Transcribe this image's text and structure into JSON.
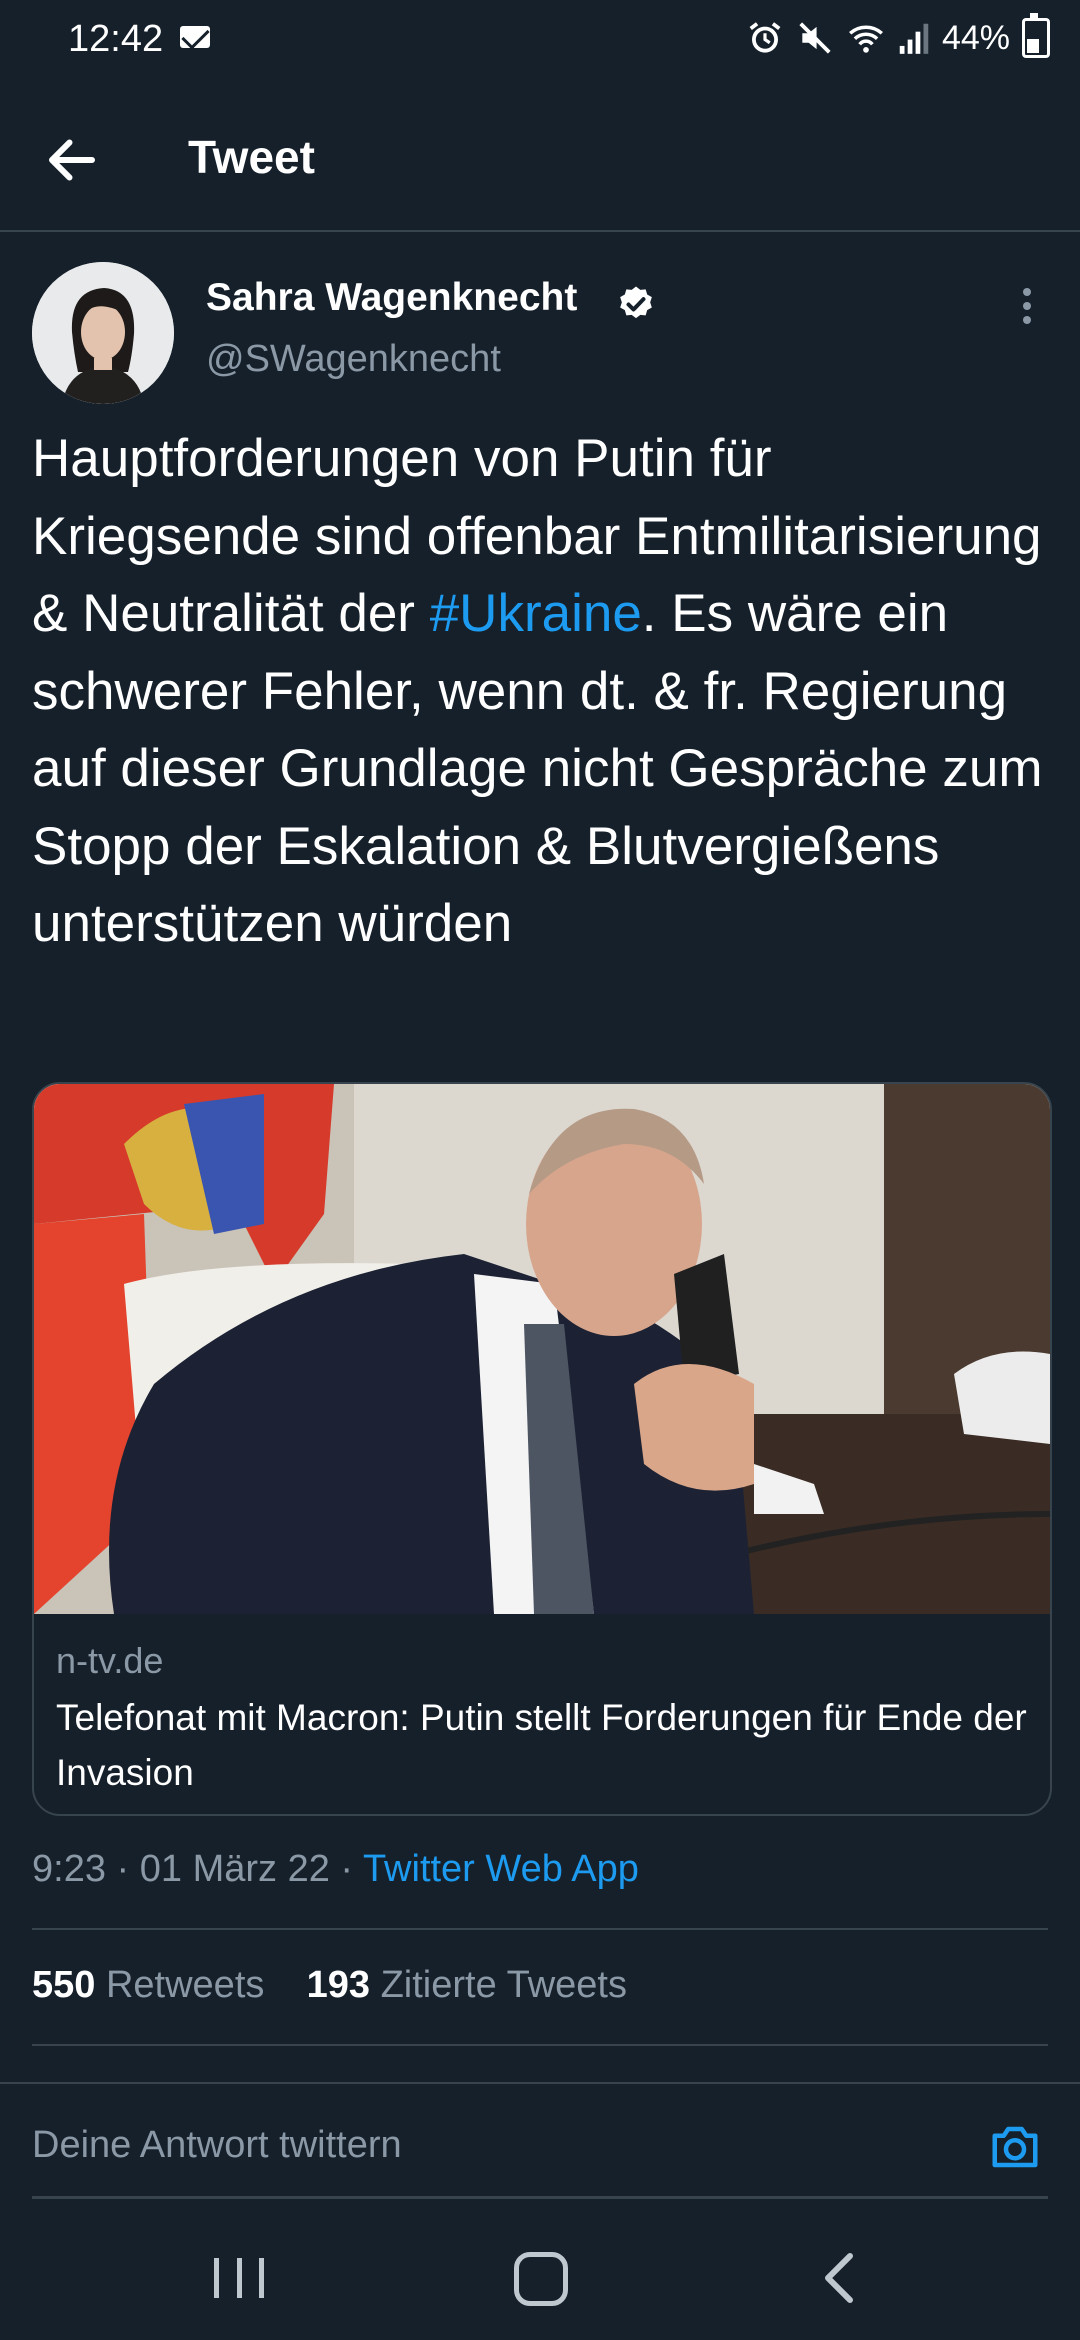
{
  "status_bar": {
    "time": "12:42",
    "battery": "44%",
    "icons": [
      "mail-icon",
      "alarm-icon",
      "mute-icon",
      "wifi-icon",
      "signal-icon",
      "battery-icon"
    ]
  },
  "header": {
    "title": "Tweet"
  },
  "tweet": {
    "author_name": "Sahra Wagenknecht",
    "handle": "@SWagenknecht",
    "text_part1": "Hauptforderungen von Putin für Kriegsende sind offenbar Entmilitarisierung & Neutralität der ",
    "hashtag": "#Ukraine",
    "text_part2": ". Es wäre ein schwerer Fehler, wenn dt. & fr. Regierung auf dieser Grundlage nicht Gespräche zum Stopp der Eskalation & Blutvergießens unterstützen würden",
    "time": "9:23",
    "date": "01 März 22",
    "source": "Twitter Web App",
    "separator": "·"
  },
  "card": {
    "domain": "n-tv.de",
    "title": "Telefonat mit Macron: Putin stellt Forderungen für Ende der Invasion"
  },
  "stats": {
    "retweets_count": "550",
    "retweets_label": "Retweets",
    "quotes_count": "193",
    "quotes_label": "Zitierte Tweets"
  },
  "reply": {
    "placeholder": "Deine Antwort twittern"
  },
  "colors": {
    "background": "#15202b",
    "accent": "#1d9bf0",
    "secondary_text": "#8b98a5",
    "divider": "#38444d"
  }
}
